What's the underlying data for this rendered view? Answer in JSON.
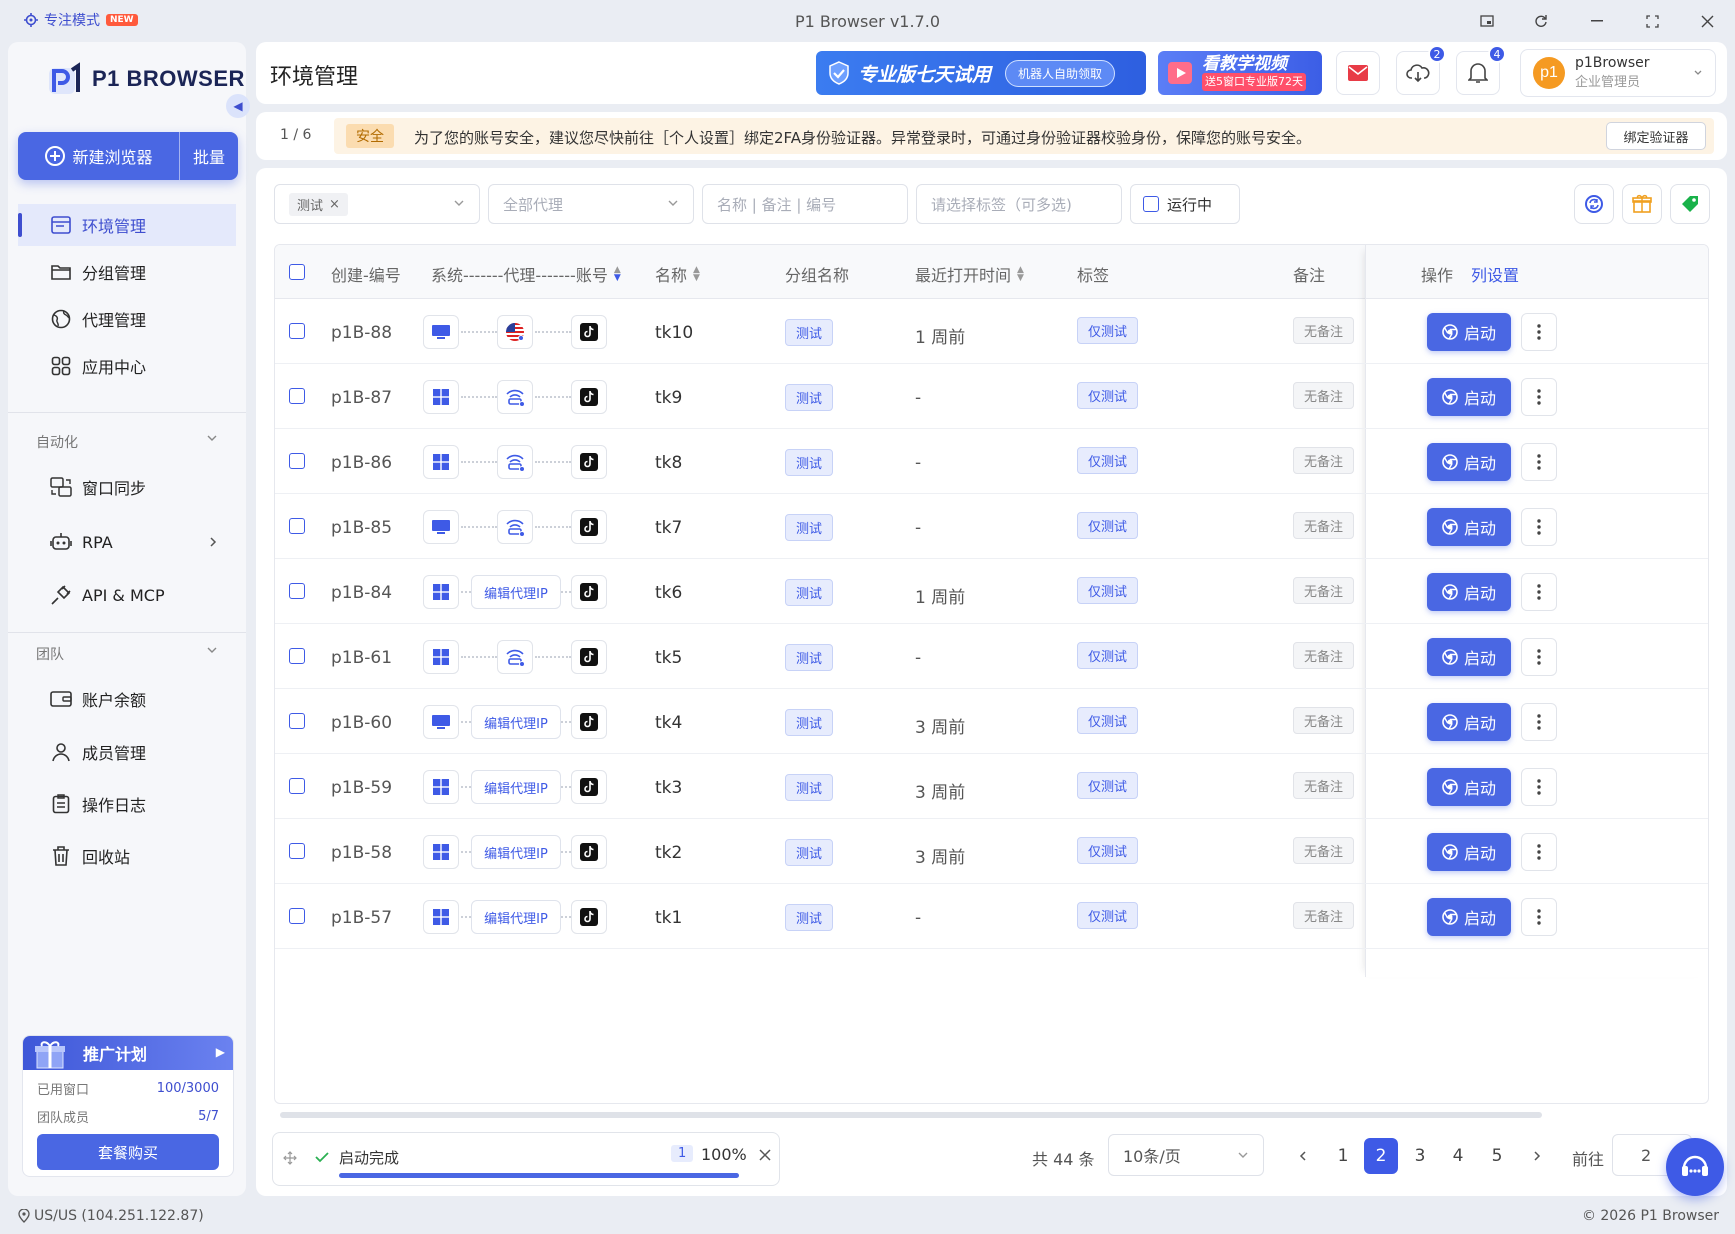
{
  "titlebar": {
    "focus_mode": "专注模式",
    "new_tag": "NEW",
    "app_title": "P1 Browser v1.7.0"
  },
  "sidebar": {
    "logo": "P1 BROWSER",
    "new_browser": "新建浏览器",
    "batch": "批量",
    "nav": [
      {
        "label": "环境管理",
        "icon": "browser-window-icon",
        "active": true
      },
      {
        "label": "分组管理",
        "icon": "folder-icon"
      },
      {
        "label": "代理管理",
        "icon": "globe-icon"
      },
      {
        "label": "应用中心",
        "icon": "apps-grid-icon"
      }
    ],
    "section_automation": "自动化",
    "automation": [
      {
        "label": "窗口同步",
        "icon": "window-sync-icon"
      },
      {
        "label": "RPA",
        "icon": "robot-icon"
      },
      {
        "label": "API & MCP",
        "icon": "plug-icon"
      }
    ],
    "section_team": "团队",
    "team": [
      {
        "label": "账户余额",
        "icon": "wallet-icon"
      },
      {
        "label": "成员管理",
        "icon": "user-icon"
      },
      {
        "label": "操作日志",
        "icon": "clipboard-icon"
      },
      {
        "label": "回收站",
        "icon": "trash-icon"
      }
    ],
    "promo": {
      "title": "推广计划",
      "used_label": "已用窗口",
      "used_value": "100/3000",
      "members_label": "团队成员",
      "members_value": "5/7",
      "buy": "套餐购买"
    }
  },
  "header": {
    "title": "环境管理",
    "trial_banner": "专业版七天试用",
    "trial_pill": "机器人自助领取",
    "video_banner": "看教学视频",
    "video_sub": "送5窗口专业版72天",
    "cloud_badge": "2",
    "bell_badge": "4",
    "user_avatar": "p1",
    "user_name": "p1Browser",
    "user_role": "企业管理员"
  },
  "notice": {
    "page": "1 / 6",
    "tag": "安全",
    "text": "为了您的账号安全，建议您尽快前往［个人设置］绑定2FA身份验证器。异常登录时，可通过身份验证器校验身份，保障您的账号安全。",
    "bind": "绑定验证器"
  },
  "filters": {
    "group_tag": "测试",
    "proxy_placeholder": "全部代理",
    "search_placeholder": "名称 | 备注 | 编号",
    "tag_placeholder": "请选择标签（可多选)",
    "running": "运行中"
  },
  "table": {
    "headers": {
      "id": "创建-编号",
      "sys": "系统-------代理-------账号",
      "name": "名称",
      "group": "分组名称",
      "time": "最近打开时间",
      "tags": "标签",
      "remark": "备注",
      "ops": "操作",
      "colset": "列设置"
    },
    "start_label": "启动",
    "rows": [
      {
        "id": "p1B-88",
        "os": "desktop",
        "proxy": "us-flag",
        "name": "tk10",
        "group": "测试",
        "time": "1 周前",
        "tag": "仅测试",
        "remark": "无备注"
      },
      {
        "id": "p1B-87",
        "os": "windows",
        "proxy": "network",
        "name": "tk9",
        "group": "测试",
        "time": "-",
        "tag": "仅测试",
        "remark": "无备注"
      },
      {
        "id": "p1B-86",
        "os": "windows",
        "proxy": "network",
        "name": "tk8",
        "group": "测试",
        "time": "-",
        "tag": "仅测试",
        "remark": "无备注"
      },
      {
        "id": "p1B-85",
        "os": "desktop",
        "proxy": "network",
        "name": "tk7",
        "group": "测试",
        "time": "-",
        "tag": "仅测试",
        "remark": "无备注"
      },
      {
        "id": "p1B-84",
        "os": "windows",
        "proxy": "edit",
        "name": "tk6",
        "group": "测试",
        "time": "1 周前",
        "tag": "仅测试",
        "remark": "无备注"
      },
      {
        "id": "p1B-61",
        "os": "windows",
        "proxy": "network",
        "name": "tk5",
        "group": "测试",
        "time": "-",
        "tag": "仅测试",
        "remark": "无备注"
      },
      {
        "id": "p1B-60",
        "os": "desktop",
        "proxy": "edit",
        "name": "tk4",
        "group": "测试",
        "time": "3 周前",
        "tag": "仅测试",
        "remark": "无备注"
      },
      {
        "id": "p1B-59",
        "os": "windows",
        "proxy": "edit",
        "name": "tk3",
        "group": "测试",
        "time": "3 周前",
        "tag": "仅测试",
        "remark": "无备注"
      },
      {
        "id": "p1B-58",
        "os": "windows",
        "proxy": "edit",
        "name": "tk2",
        "group": "测试",
        "time": "3 周前",
        "tag": "仅测试",
        "remark": "无备注"
      },
      {
        "id": "p1B-57",
        "os": "windows",
        "proxy": "edit",
        "name": "tk1",
        "group": "测试",
        "time": "-",
        "tag": "仅测试",
        "remark": "无备注"
      }
    ],
    "edit_proxy_label": "编辑代理IP"
  },
  "footer": {
    "task_text": "启动完成",
    "task_count": "1",
    "task_percent": "100%",
    "total": "共 44 条",
    "per_page": "10条/页",
    "pages": [
      "1",
      "2",
      "3",
      "4",
      "5"
    ],
    "current_page": "2",
    "goto_label": "前往",
    "goto_value": "2"
  },
  "statusbar": {
    "ip": "US/US (104.251.122.87)",
    "copyright": "© 2026 P1 Browser"
  },
  "colors": {
    "accent": "#4a67e3",
    "brand_dark": "#1b2556",
    "warn_bg": "#fdf3e4"
  }
}
